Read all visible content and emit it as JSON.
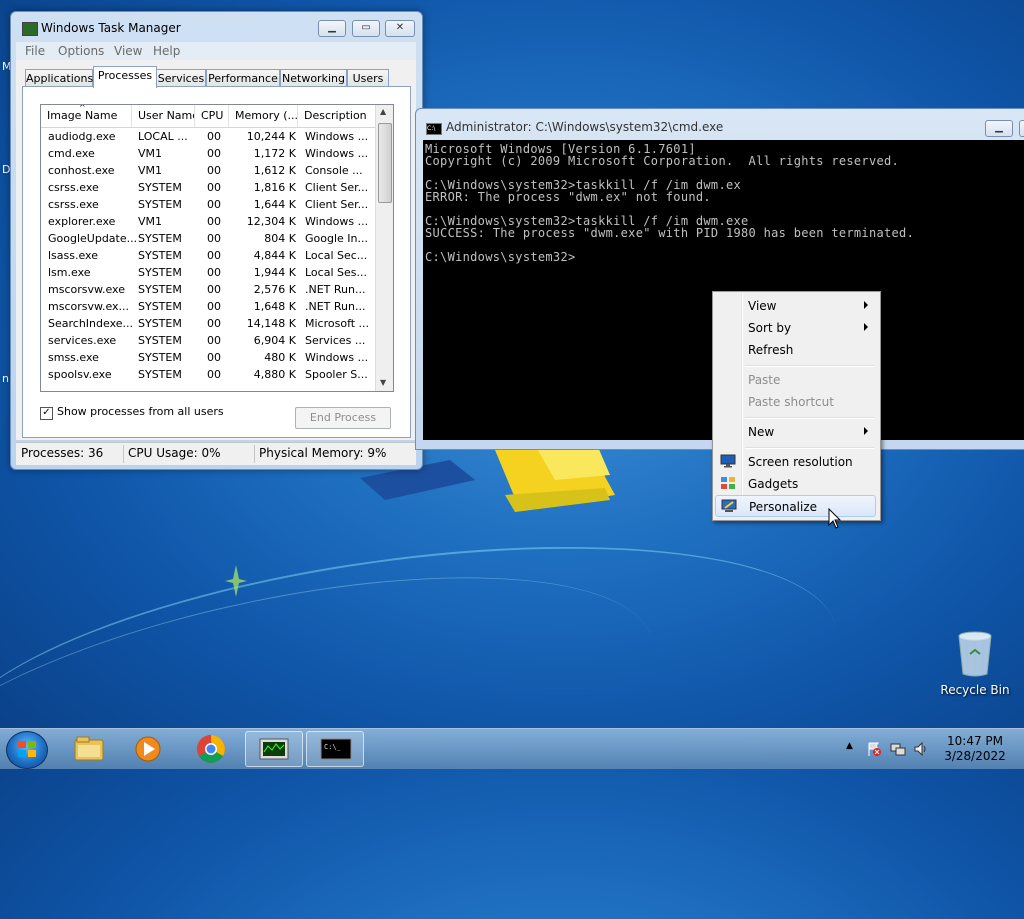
{
  "desktop": {
    "left_edge_fragments": [
      "M",
      "D",
      "n"
    ],
    "recycle_bin_label": "Recycle Bin"
  },
  "task_manager": {
    "title": "Windows Task Manager",
    "menu": [
      "File",
      "Options",
      "View",
      "Help"
    ],
    "tabs": [
      "Applications",
      "Processes",
      "Services",
      "Performance",
      "Networking",
      "Users"
    ],
    "active_tab": "Processes",
    "columns": [
      "Image Name",
      "User Name",
      "CPU",
      "Memory (...",
      "Description"
    ],
    "rows": [
      [
        "audiodg.exe",
        "LOCAL ...",
        "00",
        "10,244 K",
        "Windows ..."
      ],
      [
        "cmd.exe",
        "VM1",
        "00",
        "1,172 K",
        "Windows ..."
      ],
      [
        "conhost.exe",
        "VM1",
        "00",
        "1,612 K",
        "Console ..."
      ],
      [
        "csrss.exe",
        "SYSTEM",
        "00",
        "1,816 K",
        "Client Ser..."
      ],
      [
        "csrss.exe",
        "SYSTEM",
        "00",
        "1,644 K",
        "Client Ser..."
      ],
      [
        "explorer.exe",
        "VM1",
        "00",
        "12,304 K",
        "Windows ..."
      ],
      [
        "GoogleUpdate...",
        "SYSTEM",
        "00",
        "804 K",
        "Google In..."
      ],
      [
        "lsass.exe",
        "SYSTEM",
        "00",
        "4,844 K",
        "Local Sec..."
      ],
      [
        "lsm.exe",
        "SYSTEM",
        "00",
        "1,944 K",
        "Local Ses..."
      ],
      [
        "mscorsvw.exe",
        "SYSTEM",
        "00",
        "2,576 K",
        ".NET Run..."
      ],
      [
        "mscorsvw.ex...",
        "SYSTEM",
        "00",
        "1,648 K",
        ".NET Run..."
      ],
      [
        "SearchIndexe...",
        "SYSTEM",
        "00",
        "14,148 K",
        "Microsoft ..."
      ],
      [
        "services.exe",
        "SYSTEM",
        "00",
        "6,904 K",
        "Services ..."
      ],
      [
        "smss.exe",
        "SYSTEM",
        "00",
        "480 K",
        "Windows ..."
      ],
      [
        "spoolsv.exe",
        "SYSTEM",
        "00",
        "4,880 K",
        "Spooler S..."
      ]
    ],
    "show_all_users_label": "Show processes from all users",
    "show_all_users_checked": true,
    "end_process_label": "End Process",
    "status": {
      "processes": "Processes: 36",
      "cpu": "CPU Usage: 0%",
      "memory": "Physical Memory: 9%"
    }
  },
  "cmd": {
    "title": "Administrator: C:\\Windows\\system32\\cmd.exe",
    "lines": [
      "Microsoft Windows [Version 6.1.7601]",
      "Copyright (c) 2009 Microsoft Corporation.  All rights reserved.",
      "",
      "C:\\Windows\\system32>taskkill /f /im dwm.ex",
      "ERROR: The process \"dwm.ex\" not found.",
      "",
      "C:\\Windows\\system32>taskkill /f /im dwm.exe",
      "SUCCESS: The process \"dwm.exe\" with PID 1980 has been terminated.",
      "",
      "C:\\Windows\\system32>"
    ]
  },
  "context_menu": {
    "items": [
      {
        "label": "View",
        "submenu": true,
        "enabled": true
      },
      {
        "label": "Sort by",
        "submenu": true,
        "enabled": true
      },
      {
        "label": "Refresh",
        "submenu": false,
        "enabled": true
      },
      {
        "label": "Paste",
        "submenu": false,
        "enabled": false
      },
      {
        "label": "Paste shortcut",
        "submenu": false,
        "enabled": false
      },
      {
        "label": "New",
        "submenu": true,
        "enabled": true
      },
      {
        "label": "Screen resolution",
        "submenu": false,
        "enabled": true,
        "icon": "monitor-icon"
      },
      {
        "label": "Gadgets",
        "submenu": false,
        "enabled": true,
        "icon": "gadgets-icon"
      },
      {
        "label": "Personalize",
        "submenu": false,
        "enabled": true,
        "icon": "personalize-icon",
        "highlighted": true
      }
    ]
  },
  "taskbar": {
    "apps": [
      "windows-explorer-icon",
      "media-player-icon",
      "chrome-icon",
      "task-manager-icon",
      "cmd-icon"
    ],
    "clock_time": "10:47 PM",
    "clock_date": "3/28/2022"
  },
  "colors": {
    "desktop_blue": "#1f6fc0",
    "cmd_text": "#c0c0c0",
    "menu_highlight": "#dbe7f8"
  }
}
